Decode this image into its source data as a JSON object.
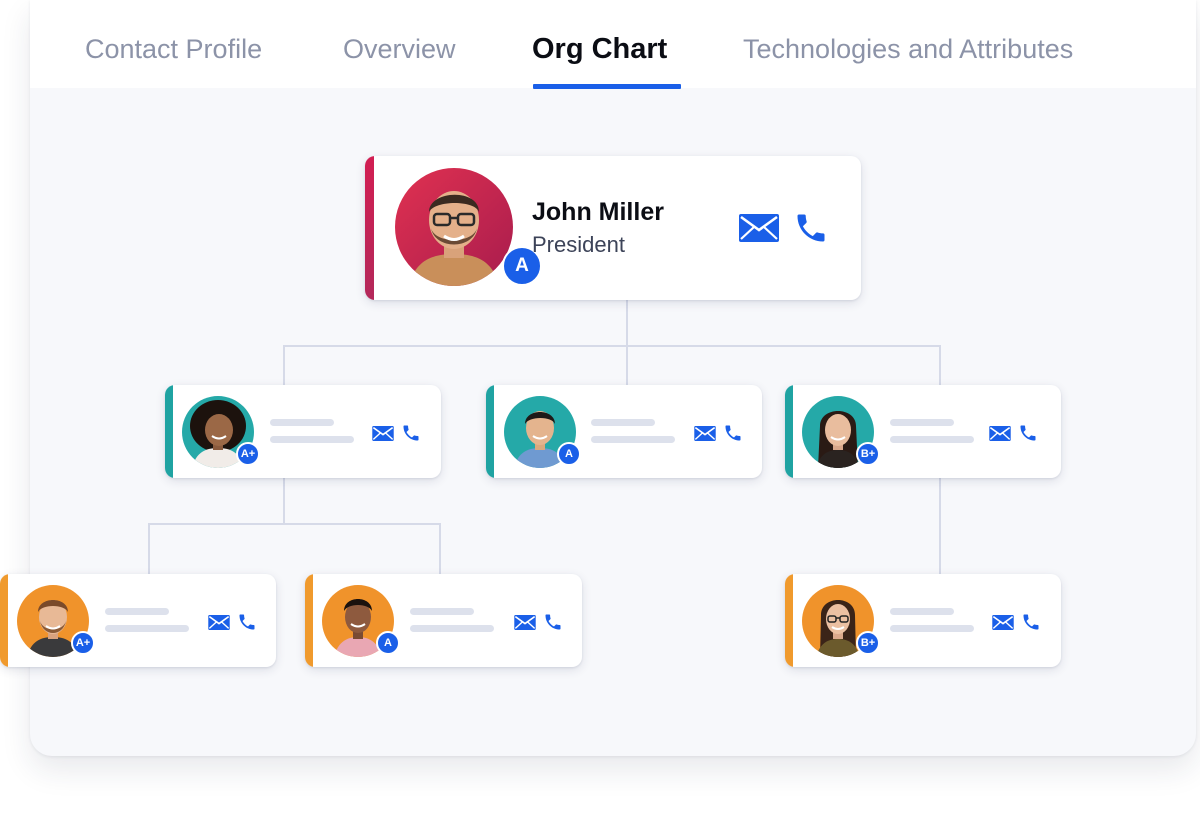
{
  "tabs": [
    {
      "label": "Contact Profile",
      "active": false
    },
    {
      "label": "Overview",
      "active": false
    },
    {
      "label": "Org Chart",
      "active": true
    },
    {
      "label": "Technologies and Attributes",
      "active": false
    }
  ],
  "colors": {
    "accent_blue": "#1a5fe8",
    "president_accent": "#c91d55",
    "level2_accent": "#1fa3a2",
    "level3_accent": "#f09a2d"
  },
  "org": {
    "president": {
      "name": "John Miller",
      "title": "President",
      "badge": "A",
      "email_icon": "envelope-icon",
      "phone_icon": "phone-icon"
    },
    "managers": [
      {
        "badge": "A+"
      },
      {
        "badge": "A"
      },
      {
        "badge": "B+"
      }
    ],
    "reports": [
      {
        "badge": "A+"
      },
      {
        "badge": "A"
      },
      {
        "badge": "B+"
      }
    ]
  }
}
